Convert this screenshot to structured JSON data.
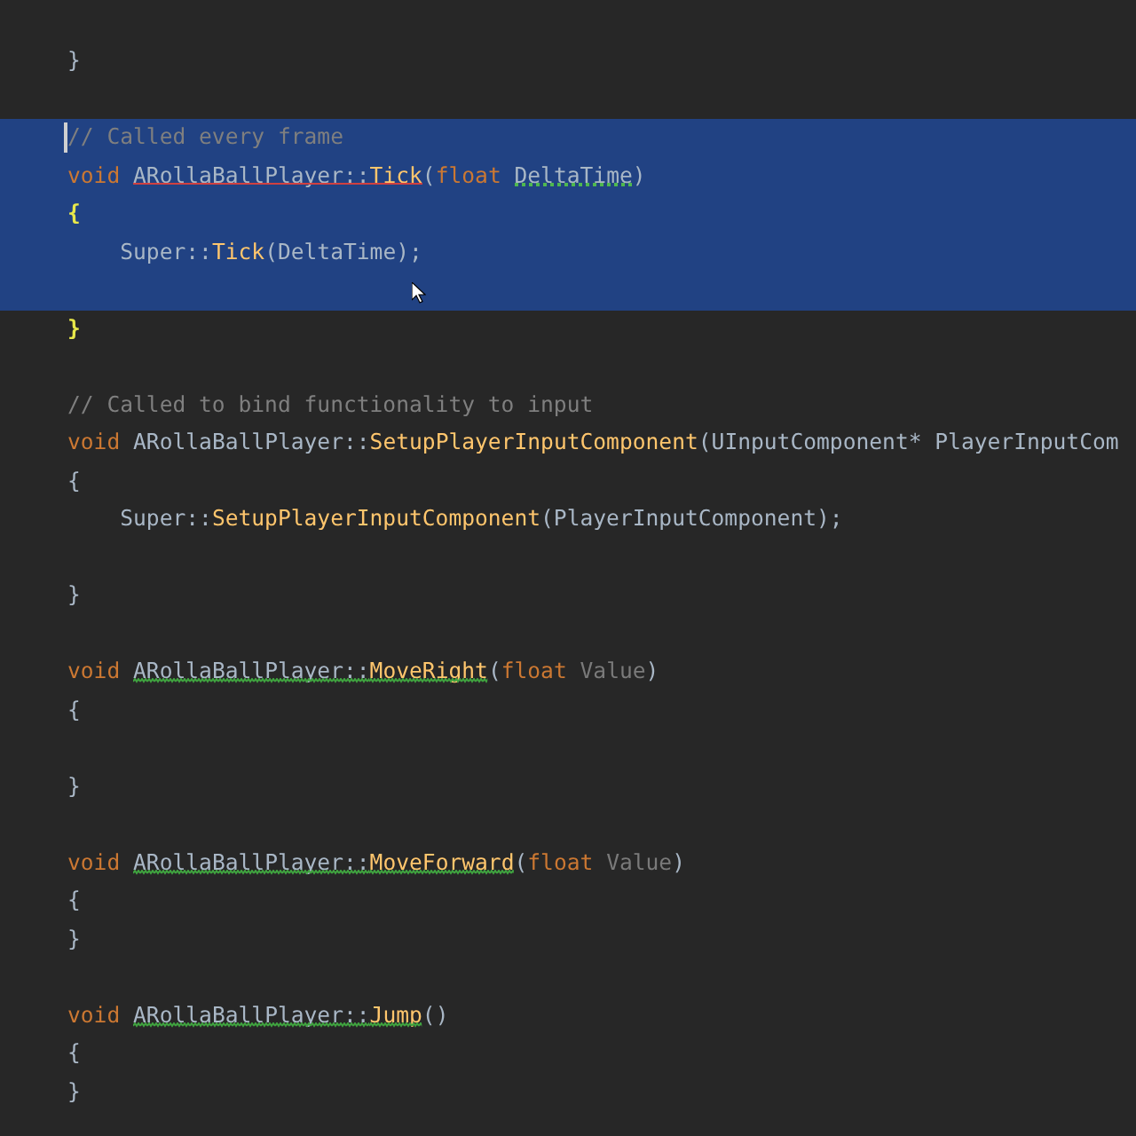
{
  "editor": {
    "before": [
      {
        "kind": "code",
        "tokens": [
          {
            "kind": "text",
            "text": "}"
          }
        ]
      },
      {
        "kind": "blank"
      }
    ],
    "selection": [
      {
        "kind": "code",
        "caret": true,
        "tokens": [
          {
            "kind": "comment",
            "text": "// Called every frame"
          }
        ]
      },
      {
        "kind": "code",
        "tokens": [
          {
            "kind": "keyword",
            "text": "void "
          },
          {
            "kind": "text",
            "text": "ARollaBallPlayer::",
            "underline": {
              "kind": "error"
            }
          },
          {
            "kind": "function",
            "text": "Tick",
            "underline": {
              "kind": "error"
            }
          },
          {
            "kind": "text",
            "text": "("
          },
          {
            "kind": "keyword",
            "text": "float "
          },
          {
            "kind": "text",
            "text": "DeltaTime",
            "underline": {
              "kind": "hint"
            }
          },
          {
            "kind": "text",
            "text": ")"
          }
        ]
      },
      {
        "kind": "code",
        "tokens": [
          {
            "kind": "brace",
            "text": "{"
          }
        ]
      },
      {
        "kind": "code",
        "tokens": [
          {
            "kind": "text",
            "text": "    Super::"
          },
          {
            "kind": "function",
            "text": "Tick"
          },
          {
            "kind": "text",
            "text": "(DeltaTime);"
          }
        ]
      },
      {
        "kind": "blank"
      }
    ],
    "after": [
      {
        "kind": "code",
        "tokens": [
          {
            "kind": "brace",
            "text": "}"
          }
        ]
      },
      {
        "kind": "blank"
      },
      {
        "kind": "code",
        "tokens": [
          {
            "kind": "comment",
            "text": "// Called to bind functionality to input"
          }
        ]
      },
      {
        "kind": "code",
        "tokens": [
          {
            "kind": "keyword",
            "text": "void "
          },
          {
            "kind": "text",
            "text": "ARollaBallPlayer::"
          },
          {
            "kind": "function",
            "text": "SetupPlayerInputComponent"
          },
          {
            "kind": "text",
            "text": "(UInputComponent* PlayerInputCom"
          }
        ]
      },
      {
        "kind": "code",
        "tokens": [
          {
            "kind": "text",
            "text": "{"
          }
        ]
      },
      {
        "kind": "code",
        "tokens": [
          {
            "kind": "text",
            "text": "    Super::"
          },
          {
            "kind": "function",
            "text": "SetupPlayerInputComponent"
          },
          {
            "kind": "text",
            "text": "(PlayerInputComponent);"
          }
        ]
      },
      {
        "kind": "blank"
      },
      {
        "kind": "code",
        "tokens": [
          {
            "kind": "text",
            "text": "}"
          }
        ]
      },
      {
        "kind": "blank"
      },
      {
        "kind": "code",
        "tokens": [
          {
            "kind": "keyword",
            "text": "void "
          },
          {
            "kind": "text",
            "text": "ARollaBallPlayer::",
            "underline": {
              "kind": "typo"
            }
          },
          {
            "kind": "function",
            "text": "MoveRight",
            "underline": {
              "kind": "typo"
            }
          },
          {
            "kind": "text",
            "text": "("
          },
          {
            "kind": "keyword",
            "text": "float "
          },
          {
            "kind": "param",
            "text": "Value"
          },
          {
            "kind": "text",
            "text": ")"
          }
        ]
      },
      {
        "kind": "code",
        "tokens": [
          {
            "kind": "text",
            "text": "{"
          }
        ]
      },
      {
        "kind": "blank"
      },
      {
        "kind": "code",
        "tokens": [
          {
            "kind": "text",
            "text": "}"
          }
        ]
      },
      {
        "kind": "blank"
      },
      {
        "kind": "code",
        "tokens": [
          {
            "kind": "keyword",
            "text": "void "
          },
          {
            "kind": "text",
            "text": "ARollaBallPlayer::",
            "underline": {
              "kind": "typo"
            }
          },
          {
            "kind": "function",
            "text": "MoveForward",
            "underline": {
              "kind": "typo"
            }
          },
          {
            "kind": "text",
            "text": "("
          },
          {
            "kind": "keyword",
            "text": "float "
          },
          {
            "kind": "param",
            "text": "Value"
          },
          {
            "kind": "text",
            "text": ")"
          }
        ]
      },
      {
        "kind": "code",
        "tokens": [
          {
            "kind": "text",
            "text": "{"
          }
        ]
      },
      {
        "kind": "code",
        "tokens": [
          {
            "kind": "text",
            "text": "}"
          }
        ]
      },
      {
        "kind": "blank"
      },
      {
        "kind": "code",
        "tokens": [
          {
            "kind": "keyword",
            "text": "void "
          },
          {
            "kind": "text",
            "text": "ARollaBallPlayer::",
            "underline": {
              "kind": "typo"
            }
          },
          {
            "kind": "function",
            "text": "Jump",
            "underline": {
              "kind": "typo"
            }
          },
          {
            "kind": "text",
            "text": "()"
          }
        ]
      },
      {
        "kind": "code",
        "tokens": [
          {
            "kind": "text",
            "text": "{"
          }
        ]
      },
      {
        "kind": "code",
        "tokens": [
          {
            "kind": "text",
            "text": "}"
          }
        ]
      }
    ]
  }
}
